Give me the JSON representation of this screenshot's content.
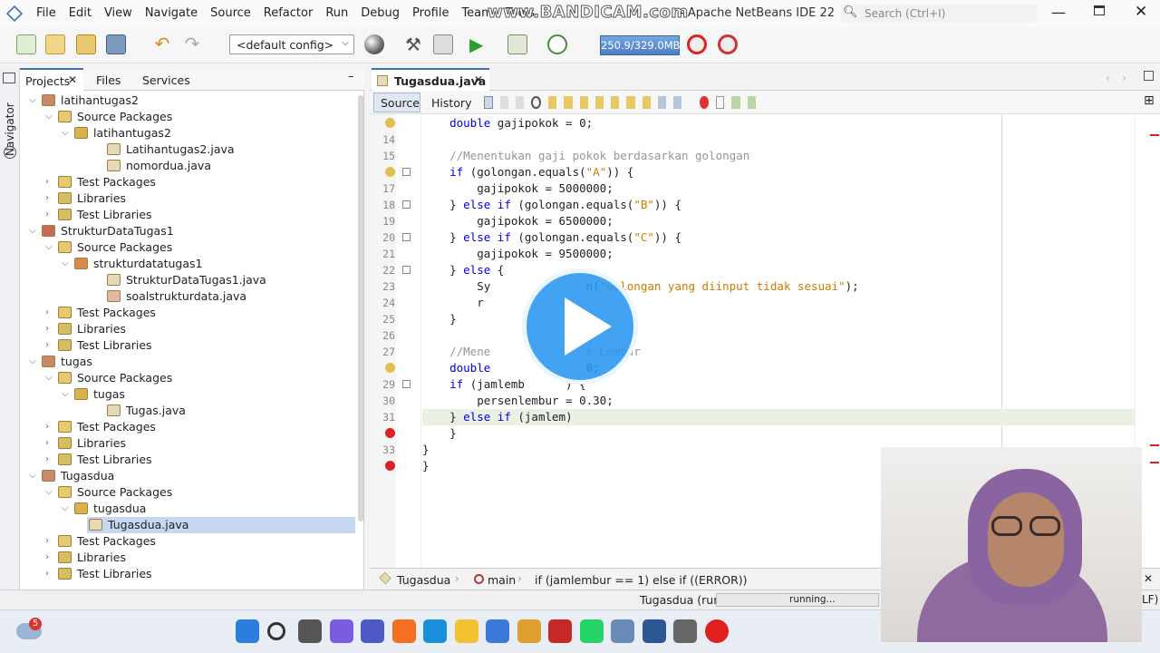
{
  "window": {
    "app_icon": "netbeans-cube-icon",
    "title": "Apache NetBeans IDE 22",
    "watermark": "www.BANDICAM.com",
    "search_placeholder": "Search (Ctrl+I)",
    "menu": [
      "File",
      "Edit",
      "View",
      "Navigate",
      "Source",
      "Refactor",
      "Run",
      "Debug",
      "Profile",
      "Team",
      "Tools"
    ]
  },
  "toolbar": {
    "config_select": "<default config>",
    "memory": "250.9/329.0MB"
  },
  "left_panel": {
    "tabs": [
      "Projects",
      "Files",
      "Services"
    ],
    "navigator_label": "Navigator",
    "tree": [
      {
        "label": "latihantugas2",
        "level": 0,
        "icon": "project-icon"
      },
      {
        "label": "Source Packages",
        "level": 1,
        "icon": "folder-package-icon"
      },
      {
        "label": "latihantugas2",
        "level": 2,
        "icon": "package-icon"
      },
      {
        "label": "Latihantugas2.java",
        "level": 3,
        "icon": "java-file-icon"
      },
      {
        "label": "nomordua.java",
        "level": 3,
        "icon": "java-file-icon"
      },
      {
        "label": "Test Packages",
        "level": 1,
        "icon": "folder-package-icon"
      },
      {
        "label": "Libraries",
        "level": 1,
        "icon": "library-icon"
      },
      {
        "label": "Test Libraries",
        "level": 1,
        "icon": "library-icon"
      },
      {
        "label": "StrukturDataTugas1",
        "level": 0,
        "icon": "project-error-icon"
      },
      {
        "label": "Source Packages",
        "level": 1,
        "icon": "folder-package-icon"
      },
      {
        "label": "strukturdatatugas1",
        "level": 2,
        "icon": "package-error-icon"
      },
      {
        "label": "StrukturDataTugas1.java",
        "level": 3,
        "icon": "java-file-icon"
      },
      {
        "label": "soalstrukturdata.java",
        "level": 3,
        "icon": "java-file-error-icon"
      },
      {
        "label": "Test Packages",
        "level": 1,
        "icon": "folder-package-icon"
      },
      {
        "label": "Libraries",
        "level": 1,
        "icon": "library-icon"
      },
      {
        "label": "Test Libraries",
        "level": 1,
        "icon": "library-icon"
      },
      {
        "label": "tugas",
        "level": 0,
        "icon": "project-icon"
      },
      {
        "label": "Source Packages",
        "level": 1,
        "icon": "folder-package-icon"
      },
      {
        "label": "tugas",
        "level": 2,
        "icon": "package-icon"
      },
      {
        "label": "Tugas.java",
        "level": 3,
        "icon": "java-file-icon"
      },
      {
        "label": "Test Packages",
        "level": 1,
        "icon": "folder-package-icon"
      },
      {
        "label": "Libraries",
        "level": 1,
        "icon": "library-icon"
      },
      {
        "label": "Test Libraries",
        "level": 1,
        "icon": "library-icon"
      },
      {
        "label": "Tugasdua",
        "level": 0,
        "icon": "project-icon"
      },
      {
        "label": "Source Packages",
        "level": 1,
        "icon": "folder-package-icon"
      },
      {
        "label": "tugasdua",
        "level": 2,
        "icon": "package-icon"
      },
      {
        "label": "Tugasdua.java",
        "level": 3,
        "icon": "java-file-icon",
        "selected": true
      },
      {
        "label": "Test Packages",
        "level": 1,
        "icon": "folder-package-icon"
      },
      {
        "label": "Libraries",
        "level": 1,
        "icon": "library-icon"
      },
      {
        "label": "Test Libraries",
        "level": 1,
        "icon": "library-icon"
      }
    ]
  },
  "editor": {
    "tab_label": "Tugasdua.java",
    "view_tabs": [
      "Source",
      "History"
    ],
    "lines": [
      {
        "n": "",
        "code": "        double gajipokok = 0;"
      },
      {
        "n": "14",
        "code": ""
      },
      {
        "n": "15",
        "code": "        //Menentukan gaji pokok berdasarkan golongan"
      },
      {
        "n": "",
        "code": "        if (golongan.equals(\"A\")) {"
      },
      {
        "n": "17",
        "code": "            gajipokok = 5000000;"
      },
      {
        "n": "18",
        "code": "        } else if (golongan.equals(\"B\")) {"
      },
      {
        "n": "19",
        "code": "            gajipokok = 6500000;"
      },
      {
        "n": "20",
        "code": "        } else if (golongan.equals(\"C\")) {"
      },
      {
        "n": "21",
        "code": "            gajipokok = 9500000;"
      },
      {
        "n": "22",
        "code": "        } else {"
      },
      {
        "n": "23",
        "code": "            Sy              n(\"Golongan yang diinput tidak sesuai\");"
      },
      {
        "n": "24",
        "code": "            r"
      },
      {
        "n": "25",
        "code": "        }"
      },
      {
        "n": "26",
        "code": ""
      },
      {
        "n": "27",
        "code": "        //Mene              e Lembur"
      },
      {
        "n": "",
        "code": "        double              0;"
      },
      {
        "n": "29",
        "code": "        if (jamlemb      ) {"
      },
      {
        "n": "30",
        "code": "            persenlembur = 0.30;"
      },
      {
        "n": "31",
        "code": "        } else if (jamlem)"
      },
      {
        "n": "",
        "code": "        }"
      },
      {
        "n": "33",
        "code": "    }"
      },
      {
        "n": "",
        "code": "}"
      }
    ],
    "breadcrumbs": [
      "Tugasdua",
      "main",
      "if (jamlembur == 1) else if ((ERROR))"
    ]
  },
  "status": {
    "run_label": "Tugasdua (run)",
    "progress_text": "running...",
    "right_fragment": "LF)"
  },
  "taskbar": {
    "weather_badge": "5",
    "apps": [
      "windows-start-icon",
      "search-icon",
      "task-view-icon",
      "copilot-icon",
      "teams-icon",
      "xampp-icon",
      "edge-icon",
      "file-explorer-icon",
      "store-icon",
      "chrome-icon",
      "mcafee-icon",
      "whatsapp-icon",
      "netbeans-icon",
      "word-icon",
      "calculator-icon",
      "bandicam-record-icon"
    ]
  },
  "colors": {
    "selection": "#c6d7ef",
    "keyword": "#0000e6",
    "string": "#ce7b00",
    "comment": "#969696",
    "play": "#2a96f0"
  }
}
